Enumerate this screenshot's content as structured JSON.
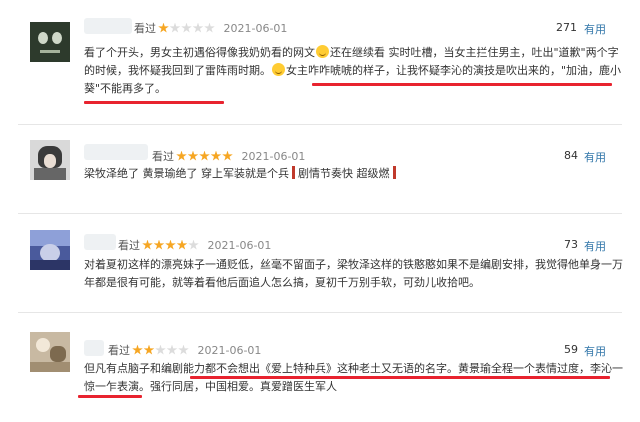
{
  "reviews": [
    {
      "watched": "看过",
      "stars": 1,
      "date": "2021-06-01",
      "count": "271",
      "useful_label": "有用",
      "text_part1": "看了个开头，男女主初遇俗得像我奶奶看的网文",
      "text_part2": "还在继续看 实时吐槽，当女主拦住男主，吐出\"道歉\"两个字的时候，我怀疑我回到了雷阵雨时期。",
      "text_part3": "女主咋咋唬唬的样子，让我怀疑李沁的演技是吹出来的，\"加油，鹿小葵\"不能再多了。"
    },
    {
      "watched": "看过",
      "stars": 5,
      "date": "2021-06-01",
      "count": "84",
      "useful_label": "有用",
      "text_part1": "梁牧泽绝了 黄景瑜绝了 穿上军装就是个兵",
      "text_part2": "剧情节奏快 超级燃"
    },
    {
      "watched": "看过",
      "stars": 4,
      "date": "2021-06-01",
      "count": "73",
      "useful_label": "有用",
      "text": "对着夏初这样的漂亮妹子一通贬低，丝毫不留面子，梁牧泽这样的铁憨憨如果不是编剧安排，我觉得他单身一万年都是很有可能，就等着看他后面追人怎么搞，夏初千万别手软，可劲儿收拾吧。"
    },
    {
      "watched": "看过",
      "stars": 2,
      "date": "2021-06-01",
      "count": "59",
      "useful_label": "有用",
      "text": "但凡有点脑子和编剧能力都不会想出《爱上特种兵》这种老土又无语的名字。黄景瑜全程一个表情过度，李沁一惊一乍表演。强行同居，中国相爱。真爱蹭医生军人"
    }
  ]
}
